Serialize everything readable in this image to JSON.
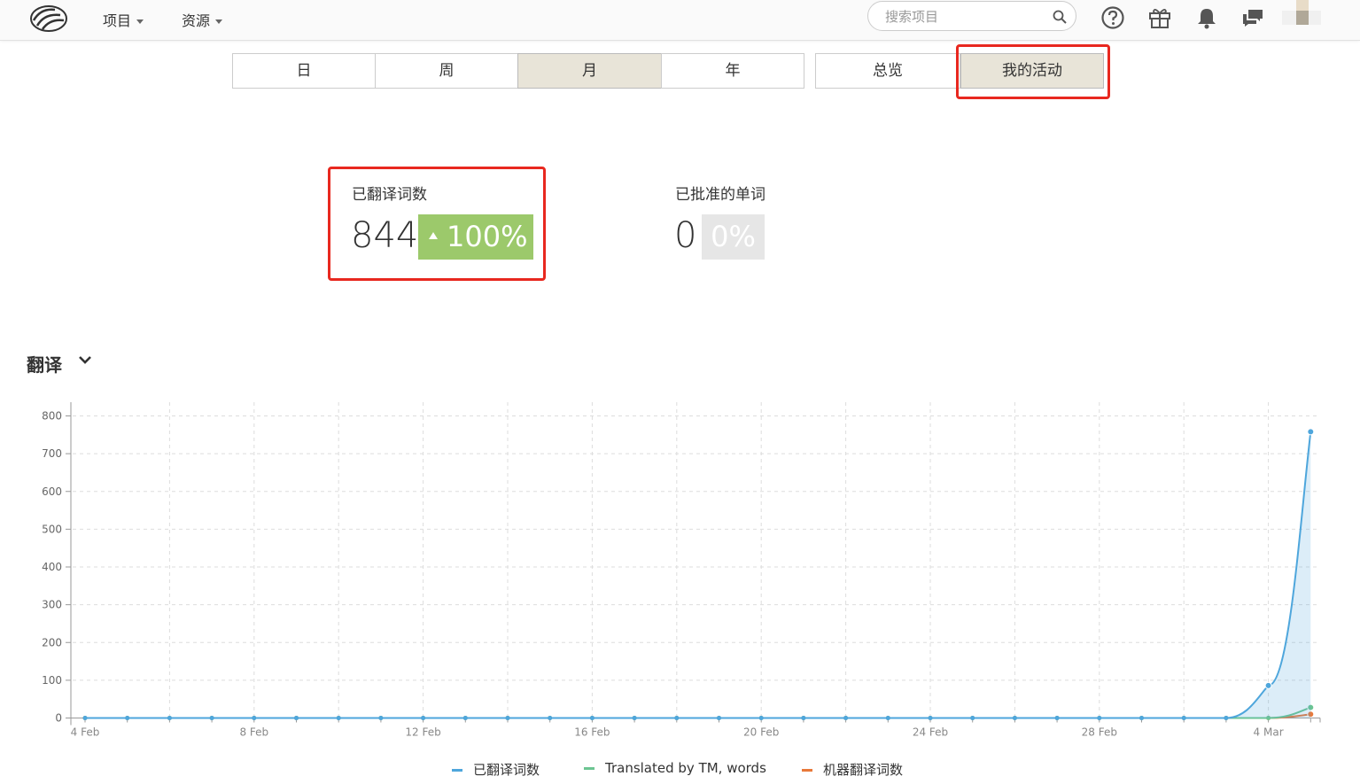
{
  "nav": {
    "menu_projects": "项目",
    "menu_resources": "资源",
    "search_placeholder": "搜索项目"
  },
  "period_tabs": [
    "日",
    "周",
    "月",
    "年"
  ],
  "active_period": "月",
  "view_tabs": [
    "总览",
    "我的活动"
  ],
  "active_view": "我的活动",
  "stats": {
    "translated": {
      "label": "已翻译词数",
      "value": "844",
      "change": "100%"
    },
    "approved": {
      "label": "已批准的单词",
      "value": "0",
      "change": "0%"
    }
  },
  "section": {
    "title": "翻译"
  },
  "colors": {
    "accent_red": "#e8281f",
    "green_badge": "#9cc96b",
    "translated": "#4ea6dc",
    "tm": "#6cc592",
    "mt": "#e8793a"
  },
  "chart_data": {
    "type": "area",
    "x": [
      "4 Feb",
      "5 Feb",
      "6 Feb",
      "7 Feb",
      "8 Feb",
      "9 Feb",
      "10 Feb",
      "11 Feb",
      "12 Feb",
      "13 Feb",
      "14 Feb",
      "15 Feb",
      "16 Feb",
      "17 Feb",
      "18 Feb",
      "19 Feb",
      "20 Feb",
      "21 Feb",
      "22 Feb",
      "23 Feb",
      "24 Feb",
      "25 Feb",
      "26 Feb",
      "27 Feb",
      "28 Feb",
      "1 Mar",
      "2 Mar",
      "3 Mar",
      "4 Mar",
      "5 Mar"
    ],
    "x_tick_labels": [
      "4 Feb",
      "8 Feb",
      "12 Feb",
      "16 Feb",
      "20 Feb",
      "24 Feb",
      "28 Feb",
      "4 Mar"
    ],
    "y_ticks": [
      0,
      100,
      200,
      300,
      400,
      500,
      600,
      700,
      800
    ],
    "ylim": [
      0,
      800
    ],
    "grid": true,
    "legend_position": "bottom",
    "series": [
      {
        "name": "已翻译词数",
        "color": "#4ea6dc",
        "values": [
          0,
          0,
          0,
          0,
          0,
          0,
          0,
          0,
          0,
          0,
          0,
          0,
          0,
          0,
          0,
          0,
          0,
          0,
          0,
          0,
          0,
          0,
          0,
          0,
          0,
          0,
          0,
          0,
          86,
          758
        ]
      },
      {
        "name": "Translated by TM, words",
        "color": "#6cc592",
        "values": [
          0,
          0,
          0,
          0,
          0,
          0,
          0,
          0,
          0,
          0,
          0,
          0,
          0,
          0,
          0,
          0,
          0,
          0,
          0,
          0,
          0,
          0,
          0,
          0,
          0,
          0,
          0,
          0,
          0,
          28
        ]
      },
      {
        "name": "机器翻译词数",
        "color": "#e8793a",
        "values": [
          0,
          0,
          0,
          0,
          0,
          0,
          0,
          0,
          0,
          0,
          0,
          0,
          0,
          0,
          0,
          0,
          0,
          0,
          0,
          0,
          0,
          0,
          0,
          0,
          0,
          0,
          0,
          0,
          0,
          10
        ]
      }
    ]
  }
}
